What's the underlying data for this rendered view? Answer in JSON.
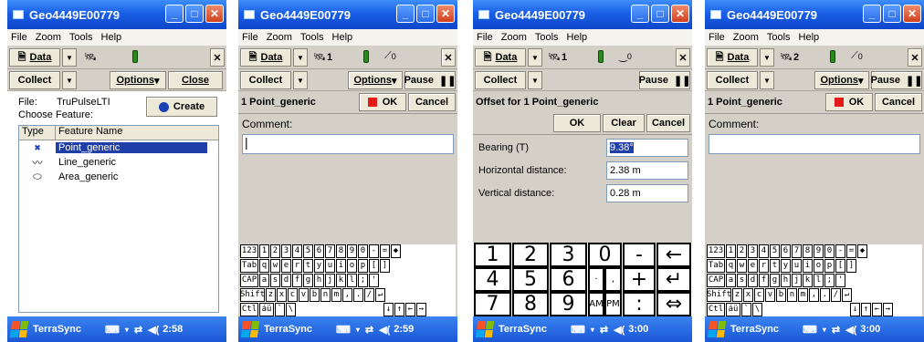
{
  "app": {
    "title": "Geo4449E00779"
  },
  "menu": [
    "File",
    "Zoom",
    "Tools",
    "Help"
  ],
  "toolbar": {
    "data_label": "Data",
    "collect_label": "Collect",
    "options_label": "Options",
    "close_label": "Close",
    "pause_label": "Pause",
    "ok_label": "OK",
    "cancel_label": "Cancel",
    "clear_label": "Clear",
    "create_label": "Create"
  },
  "screen1": {
    "file_label": "File:",
    "file_value": "TruPulseLTI",
    "choose_label": "Choose Feature:",
    "columns": [
      "Type",
      "Feature Name"
    ],
    "features": [
      "Point_generic",
      "Line_generic",
      "Area_generic"
    ],
    "time": "2:58"
  },
  "screen2": {
    "header": "1 Point_generic",
    "comment_label": "Comment:",
    "sat_count": "1",
    "laser_count": "0",
    "time": "2:59"
  },
  "screen3": {
    "header": "Offset for 1 Point_generic",
    "sat_count": "1",
    "laser_count": "0",
    "fields": [
      {
        "label": "Bearing (T)",
        "value": "9.38°"
      },
      {
        "label": "Horizontal distance:",
        "value": "2.38 m"
      },
      {
        "label": "Vertical distance:",
        "value": "0.28 m"
      }
    ],
    "numpad": [
      "1",
      "2",
      "3",
      "0",
      "-",
      "←",
      "4",
      "5",
      "6",
      "·",
      ",",
      "+",
      "↵",
      "7",
      "8",
      "9",
      "AM",
      "PM",
      ":",
      "⇔"
    ],
    "time": "3:00"
  },
  "screen4": {
    "header": "1 Point_generic",
    "comment_label": "Comment:",
    "sat_count": "2",
    "laser_count": "0",
    "time": "3:00"
  },
  "taskbar": {
    "app_label": "TerraSync"
  },
  "keyboard": {
    "row1": [
      "123",
      "1",
      "2",
      "3",
      "4",
      "5",
      "6",
      "7",
      "8",
      "9",
      "0",
      "-",
      "=",
      "◆"
    ],
    "row2": [
      "Tab",
      "q",
      "w",
      "e",
      "r",
      "t",
      "y",
      "u",
      "i",
      "o",
      "p",
      "[",
      "]"
    ],
    "row3": [
      "CAP",
      "a",
      "s",
      "d",
      "f",
      "g",
      "h",
      "j",
      "k",
      "l",
      ";",
      "'"
    ],
    "row4": [
      "Shift",
      "z",
      "x",
      "c",
      "v",
      "b",
      "n",
      "m",
      ",",
      ".",
      "/",
      "↵"
    ],
    "row5": [
      "Ctl",
      "áü",
      "`",
      "\\",
      "↓",
      "↑",
      "←",
      "→"
    ]
  },
  "colors": {
    "titlebar": "#1a5fe6",
    "selection": "#1f3fa8",
    "ok_red": "#e61919",
    "battery": "#2a8a1e"
  }
}
